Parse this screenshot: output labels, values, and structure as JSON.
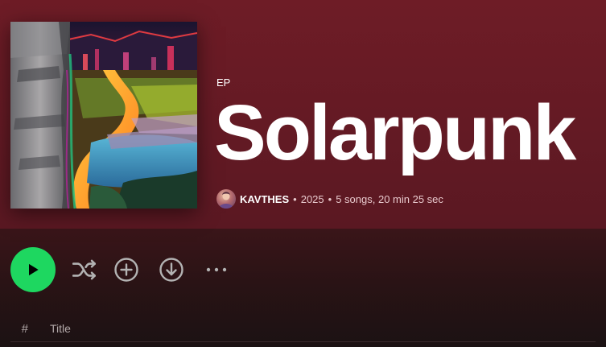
{
  "album": {
    "type_label": "EP",
    "title": "Solarpunk",
    "artist": "KAVTHES",
    "year": "2025",
    "songs_summary": "5 songs, 20 min 25 sec",
    "separator": "•"
  },
  "controls": {
    "play_icon": "play-icon",
    "shuffle_icon": "shuffle-icon",
    "add_icon": "add-circle-icon",
    "download_icon": "download-icon",
    "more_icon": "more-options-icon"
  },
  "tracklist": {
    "header_number": "#",
    "header_title": "Title"
  },
  "colors": {
    "accent": "#1ed760",
    "hero_bg": "#6e1c26",
    "dim_text": "#e8c9cd"
  }
}
